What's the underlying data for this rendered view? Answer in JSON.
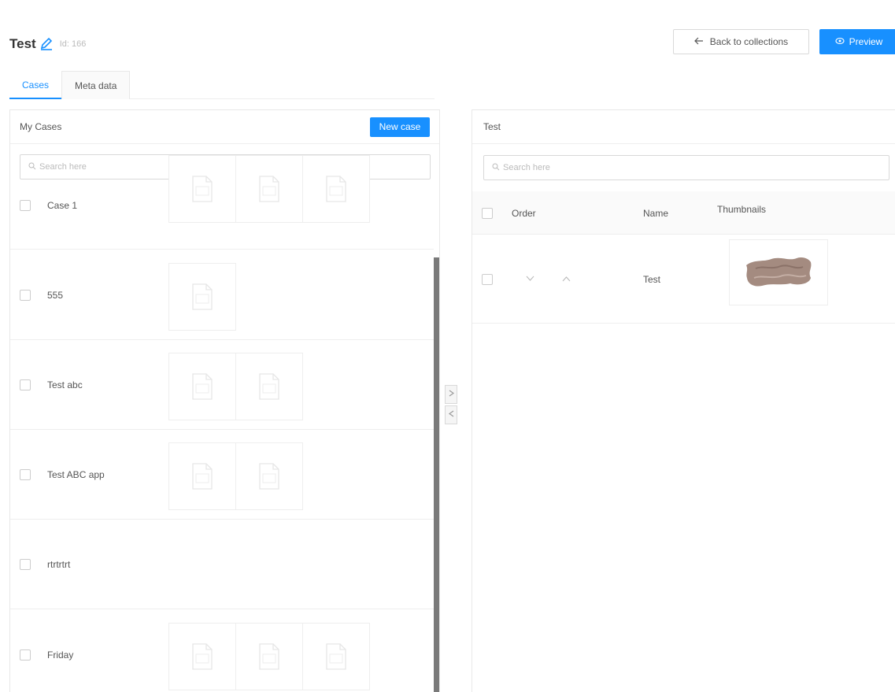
{
  "header": {
    "title": "Test",
    "id_label": "Id: 166",
    "back_label": "Back to collections",
    "preview_label": "Preview"
  },
  "tabs": [
    {
      "label": "Cases",
      "active": true
    },
    {
      "label": "Meta data",
      "active": false
    }
  ],
  "left_panel": {
    "title": "My Cases",
    "new_case_label": "New case",
    "search_placeholder": "Search here",
    "cases": [
      {
        "name": "Case 1",
        "thumbnails": 3
      },
      {
        "name": "555",
        "thumbnails": 1
      },
      {
        "name": "Test abc",
        "thumbnails": 2
      },
      {
        "name": "Test ABC app",
        "thumbnails": 2
      },
      {
        "name": "rtrtrtrt",
        "thumbnails": 0
      },
      {
        "name": "Friday",
        "thumbnails": 3
      }
    ]
  },
  "transfer": {
    "right_icon": "chevron-right-icon",
    "left_icon": "chevron-left-icon"
  },
  "right_panel": {
    "title": "Test",
    "search_placeholder": "Search here",
    "columns": [
      "Order",
      "Name",
      "Thumbnails"
    ],
    "rows": [
      {
        "name": "Test",
        "has_thumbnail": true
      }
    ]
  },
  "colors": {
    "accent": "#1890ff",
    "border": "#e8e8e8",
    "scrollbar": "#7a7a7a"
  }
}
